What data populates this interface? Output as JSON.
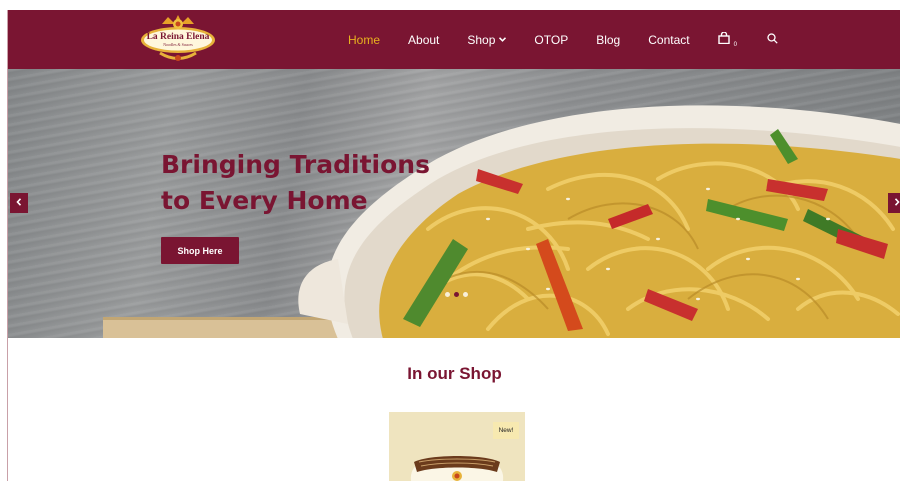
{
  "brand": {
    "name": "La Reina Elena",
    "tagline": "Noodles & Sauces",
    "colors": {
      "primary": "#7a1532",
      "accent": "#e8b21e"
    }
  },
  "nav": {
    "items": [
      {
        "label": "Home",
        "active": true
      },
      {
        "label": "About"
      },
      {
        "label": "Shop",
        "has_dropdown": true
      },
      {
        "label": "OTOP"
      },
      {
        "label": "Blog"
      },
      {
        "label": "Contact"
      }
    ],
    "cart": {
      "icon": "shopping-bag-icon",
      "count": "0"
    },
    "search": {
      "icon": "search-icon"
    }
  },
  "hero": {
    "title": "Bringing Traditions to Every Home",
    "button_label": "Shop Here",
    "slides": 3,
    "active_slide": 2,
    "prev_icon": "chevron-left-icon",
    "next_icon": "chevron-right-icon"
  },
  "shop": {
    "title": "In our Shop",
    "products": [
      {
        "badge": "New!"
      }
    ]
  }
}
